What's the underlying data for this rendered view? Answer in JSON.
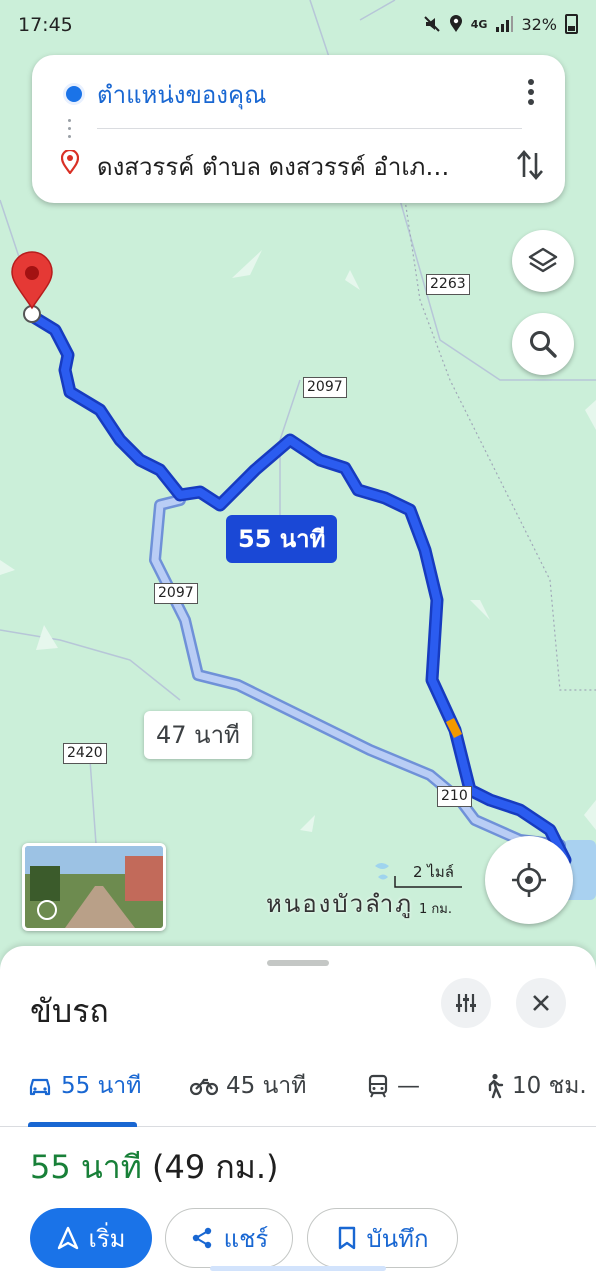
{
  "status_bar": {
    "time": "17:45",
    "network": "4G",
    "battery": "32%"
  },
  "directions": {
    "origin": "ตำแหน่งของคุณ",
    "destination": "ดงสวรรค์ ตำบล ดงสวรรค์ อำเภ…",
    "icons": {
      "origin": "blue-dot-icon",
      "destination": "red-pin-icon",
      "more": "more-vert-icon",
      "swap": "swap-vert-icon"
    }
  },
  "map": {
    "primary_route_label": "55 นาที",
    "alt_route_label": "47 นาที",
    "road_shields": [
      "2263",
      "2097",
      "2097",
      "2420",
      "210"
    ],
    "scale_label": "2 ไมล์",
    "scale_km": "1 กม.",
    "place_name": "หนองบัวลำภู",
    "colors": {
      "primary_route": "#1a48d6",
      "alt_route": "#a9c4f2",
      "map_bg": "#cbefd9",
      "traffic": "#f29900"
    },
    "buttons": {
      "layers": "layers-icon",
      "search": "search-icon",
      "my_location": "my-location-icon",
      "streetview": "street-view-thumbnail"
    }
  },
  "sheet": {
    "title": "ขับรถ",
    "tabs": [
      {
        "icon": "car-icon",
        "label": "55 นาที"
      },
      {
        "icon": "motorcycle-icon",
        "label": "45 นาที"
      },
      {
        "icon": "transit-icon",
        "label": "—"
      },
      {
        "icon": "walk-icon",
        "label": "10 ชม."
      }
    ],
    "duration": "55 นาที",
    "distance": "(49 กม.)",
    "actions": {
      "start": "เริ่ม",
      "share": "แชร์",
      "save": "บันทึก"
    }
  }
}
